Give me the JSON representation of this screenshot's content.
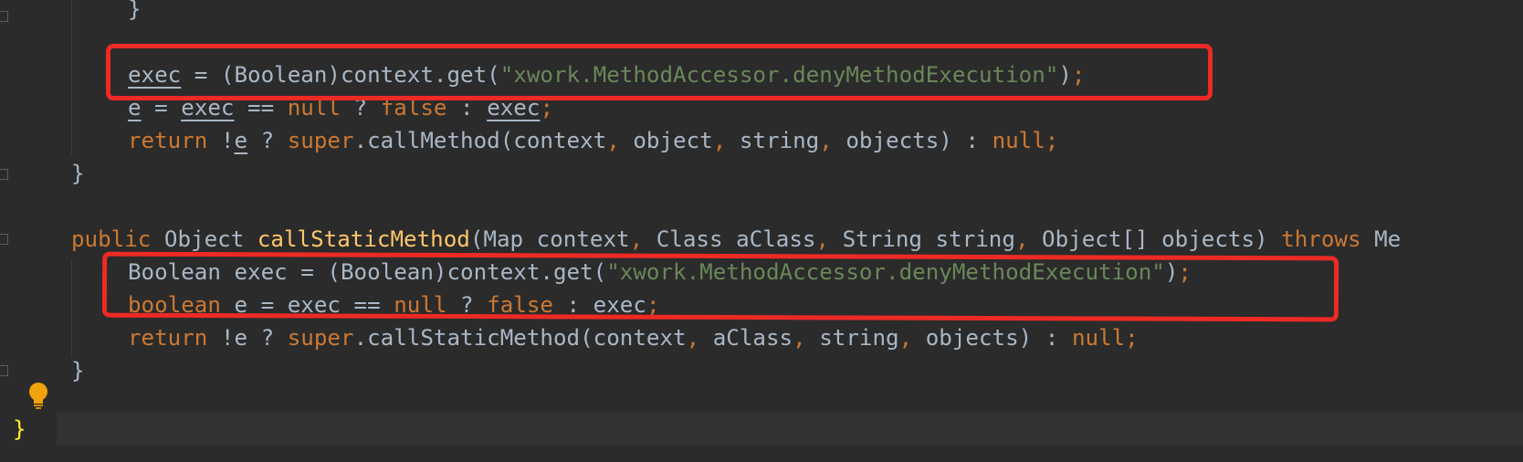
{
  "editor": {
    "lines": [
      {
        "id": "l1",
        "tokens": [
          {
            "t": "}",
            "c": "plain"
          }
        ]
      },
      {
        "id": "l2",
        "tokens": []
      },
      {
        "id": "l3",
        "tokens": [
          {
            "t": "exec",
            "c": "u"
          },
          {
            "t": " = (Boolean)context.get(",
            "c": "plain"
          },
          {
            "t": "\"xwork.MethodAccessor.denyMethodExecution\"",
            "c": "str"
          },
          {
            "t": ")",
            "c": "plain"
          },
          {
            "t": ";",
            "c": "kw"
          }
        ]
      },
      {
        "id": "l4",
        "tokens": [
          {
            "t": "e",
            "c": "u"
          },
          {
            "t": " = ",
            "c": "plain"
          },
          {
            "t": "exec",
            "c": "u"
          },
          {
            "t": " == ",
            "c": "plain"
          },
          {
            "t": "null",
            "c": "kw"
          },
          {
            "t": " ? ",
            "c": "plain"
          },
          {
            "t": "false",
            "c": "kw"
          },
          {
            "t": " : ",
            "c": "plain"
          },
          {
            "t": "exec",
            "c": "u"
          },
          {
            "t": ";",
            "c": "kw"
          }
        ]
      },
      {
        "id": "l5",
        "tokens": [
          {
            "t": "return",
            "c": "kw"
          },
          {
            "t": " !",
            "c": "plain"
          },
          {
            "t": "e",
            "c": "u"
          },
          {
            "t": " ? ",
            "c": "plain"
          },
          {
            "t": "super",
            "c": "kw"
          },
          {
            "t": ".callMethod(context",
            "c": "plain"
          },
          {
            "t": ",",
            "c": "kw"
          },
          {
            "t": " object",
            "c": "plain"
          },
          {
            "t": ",",
            "c": "kw"
          },
          {
            "t": " string",
            "c": "plain"
          },
          {
            "t": ",",
            "c": "kw"
          },
          {
            "t": " objects) : ",
            "c": "plain"
          },
          {
            "t": "null;",
            "c": "kw"
          }
        ]
      },
      {
        "id": "l6",
        "tokens": [
          {
            "t": "}",
            "c": "plain"
          }
        ]
      },
      {
        "id": "l7",
        "tokens": []
      },
      {
        "id": "l8",
        "tokens": [
          {
            "t": "public",
            "c": "kw"
          },
          {
            "t": " Object ",
            "c": "plain"
          },
          {
            "t": "callStaticMethod",
            "c": "fn"
          },
          {
            "t": "(Map context",
            "c": "plain"
          },
          {
            "t": ",",
            "c": "kw"
          },
          {
            "t": " Class aClass",
            "c": "plain"
          },
          {
            "t": ",",
            "c": "kw"
          },
          {
            "t": " String string",
            "c": "plain"
          },
          {
            "t": ",",
            "c": "kw"
          },
          {
            "t": " Object[] objects) ",
            "c": "plain"
          },
          {
            "t": "throws",
            "c": "kw"
          },
          {
            "t": " Me",
            "c": "plain"
          }
        ]
      },
      {
        "id": "l9",
        "tokens": [
          {
            "t": "Boolean exec = (Boolean)context.get(",
            "c": "plain"
          },
          {
            "t": "\"xwork.MethodAccessor.denyMethodExecution\"",
            "c": "str"
          },
          {
            "t": ")",
            "c": "plain"
          },
          {
            "t": ";",
            "c": "kw"
          }
        ]
      },
      {
        "id": "l10",
        "tokens": [
          {
            "t": "boolean",
            "c": "kw"
          },
          {
            "t": " e = exec == ",
            "c": "plain"
          },
          {
            "t": "null",
            "c": "kw"
          },
          {
            "t": " ? ",
            "c": "plain"
          },
          {
            "t": "false",
            "c": "kw"
          },
          {
            "t": " : exec",
            "c": "plain"
          },
          {
            "t": ";",
            "c": "kw"
          }
        ]
      },
      {
        "id": "l11",
        "tokens": [
          {
            "t": "return",
            "c": "kw"
          },
          {
            "t": " !e ? ",
            "c": "plain"
          },
          {
            "t": "super",
            "c": "kw"
          },
          {
            "t": ".callStaticMethod(context",
            "c": "plain"
          },
          {
            "t": ",",
            "c": "kw"
          },
          {
            "t": " aClass",
            "c": "plain"
          },
          {
            "t": ",",
            "c": "kw"
          },
          {
            "t": " string",
            "c": "plain"
          },
          {
            "t": ",",
            "c": "kw"
          },
          {
            "t": " objects) : ",
            "c": "plain"
          },
          {
            "t": "null;",
            "c": "kw"
          }
        ]
      },
      {
        "id": "l12",
        "tokens": [
          {
            "t": "}",
            "c": "plain"
          }
        ]
      },
      {
        "id": "l13",
        "tokens": [
          {
            "t": "}",
            "c": "brace-hl"
          }
        ]
      }
    ]
  },
  "colors": {
    "background": "#2b2b2b",
    "keyword": "#cc7832",
    "string": "#6a8759",
    "method_declaration": "#ffc66d",
    "plain_text": "#a9b7c6",
    "annotation_box": "#ee2a25"
  },
  "icons": {
    "intention": "lightbulb-icon"
  }
}
